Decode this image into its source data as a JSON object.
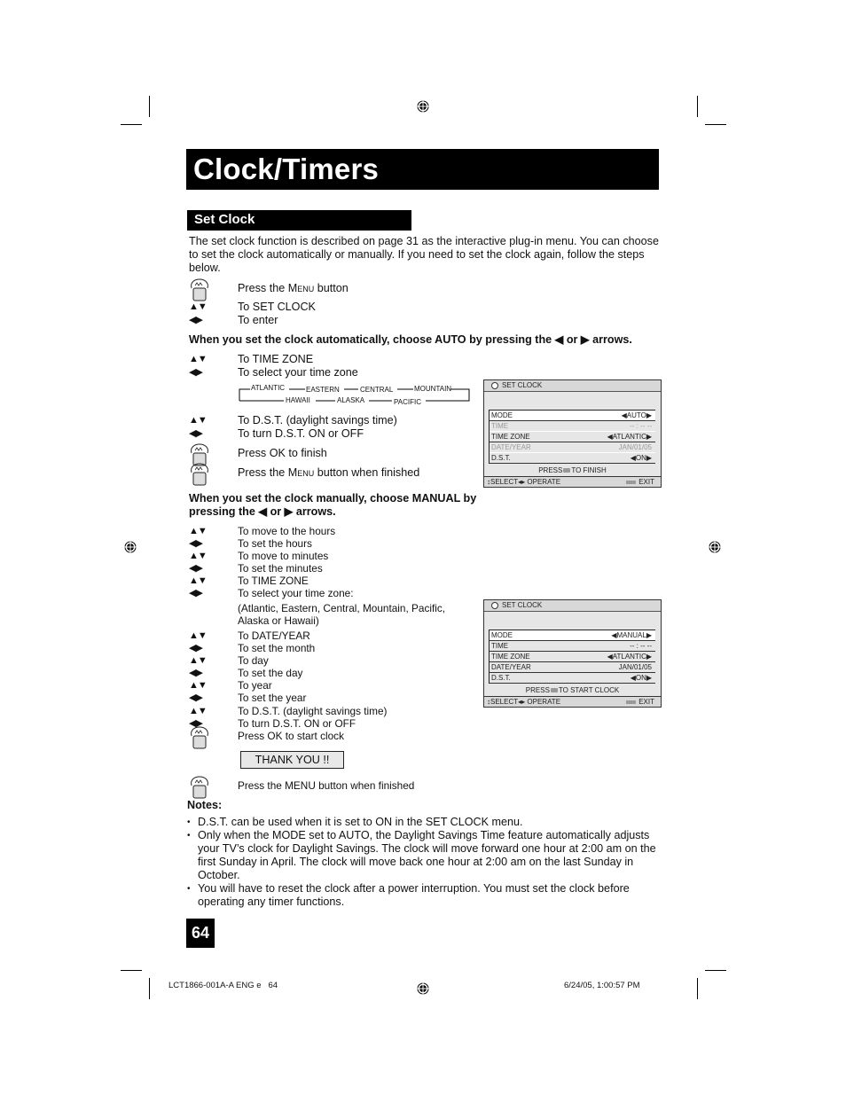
{
  "page": {
    "title": "Clock/Timers",
    "section_title": "Set Clock",
    "intro": "The set clock function is described on page 31 as the interactive plug-in menu. You can choose to set the clock automatically or manually. If you need to set the clock again, follow the steps below.",
    "page_number": "64"
  },
  "icons": {
    "up_down": "▲▼",
    "left_right": "◀▶",
    "hand": "hand-press-icon"
  },
  "steps_intro": [
    {
      "icon": "hand",
      "text_pre": "Press the ",
      "text_sc": "Menu",
      "text_post": " button"
    },
    {
      "icon": "up_down",
      "text": "To SET CLOCK"
    },
    {
      "icon": "left_right",
      "text": "To enter"
    }
  ],
  "auto_heading": "When you set the clock automatically, choose AUTO by pressing the ◀ or ▶ arrows.",
  "steps_auto": [
    {
      "icon": "up_down",
      "text": "To TIME ZONE"
    },
    {
      "icon": "left_right",
      "text": "To select your time zone"
    },
    {
      "icon": "up_down",
      "text": "To D.S.T. (daylight savings time)"
    },
    {
      "icon": "left_right",
      "text": "To turn D.S.T. ON or OFF"
    },
    {
      "icon": "hand",
      "text": "Press OK to finish"
    },
    {
      "icon": "hand",
      "text_pre": "Press the ",
      "text_sc": "Menu",
      "text_post": " button when finished"
    }
  ],
  "timezone_cycle": {
    "top": [
      "ATLANTIC",
      "EASTERN",
      "CENTRAL",
      "MOUNTAIN"
    ],
    "bottom": [
      "HAWAII",
      "ALASKA",
      "PACIFIC"
    ]
  },
  "osd_auto": {
    "header": "SET CLOCK",
    "rows": [
      {
        "label": "MODE",
        "value": "AUTO",
        "arrows": true,
        "state": "highlighted"
      },
      {
        "label": "TIME",
        "value": "-- : -- --",
        "arrows": false,
        "state": "dimmed"
      },
      {
        "label": "TIME ZONE",
        "value": "ATLANTIC",
        "arrows": true,
        "state": "normal"
      },
      {
        "label": "DATE/YEAR",
        "value": "JAN/01/05",
        "arrows": false,
        "state": "dimmed"
      },
      {
        "label": "D.S.T.",
        "value": "ON",
        "arrows": true,
        "state": "normal"
      }
    ],
    "press_pre": "PRESS",
    "press_post": "TO FINISH",
    "footer_left": "SELECT",
    "footer_mid": "OPERATE",
    "footer_right": "EXIT"
  },
  "manual_heading": "When you set the clock manually, choose MANUAL by pressing the ◀ or ▶ arrows.",
  "steps_manual": [
    {
      "icon": "up_down",
      "text": "To move to the hours"
    },
    {
      "icon": "left_right",
      "text": "To set the hours"
    },
    {
      "icon": "up_down",
      "text": "To move to minutes"
    },
    {
      "icon": "left_right",
      "text": "To set the minutes"
    },
    {
      "icon": "up_down",
      "text": "To TIME ZONE"
    },
    {
      "icon": "left_right",
      "text": "To select your time zone:"
    },
    {
      "icon": "",
      "text": "(Atlantic, Eastern, Central, Mountain, Pacific,"
    },
    {
      "icon": "",
      "text": "Alaska or Hawaii)"
    },
    {
      "icon": "up_down",
      "text": "To DATE/YEAR"
    },
    {
      "icon": "left_right",
      "text": "To set the month"
    },
    {
      "icon": "up_down",
      "text": "To day"
    },
    {
      "icon": "left_right",
      "text": "To set the day"
    },
    {
      "icon": "up_down",
      "text": "To year"
    },
    {
      "icon": "left_right",
      "text": "To set the year"
    },
    {
      "icon": "up_down",
      "text": "To D.S.T. (daylight savings time)"
    },
    {
      "icon": "left_right",
      "text": "To turn D.S.T. ON or OFF"
    },
    {
      "icon": "hand",
      "text": "Press OK to start clock"
    }
  ],
  "thank_you": "THANK YOU !!",
  "final_step": "Press the MENU button when finished",
  "osd_manual": {
    "header": "SET CLOCK",
    "rows": [
      {
        "label": "MODE",
        "value": "MANUAL",
        "arrows": true,
        "state": "highlighted"
      },
      {
        "label": "TIME",
        "value": "-- : -- --",
        "arrows": false,
        "state": "normal"
      },
      {
        "label": "TIME ZONE",
        "value": "ATLANTIC",
        "arrows": true,
        "state": "normal"
      },
      {
        "label": "DATE/YEAR",
        "value": "JAN/01/05",
        "arrows": false,
        "state": "normal"
      },
      {
        "label": "D.S.T.",
        "value": "ON",
        "arrows": true,
        "state": "normal"
      }
    ],
    "press_pre": "PRESS",
    "press_post": "TO START CLOCK",
    "footer_left": "SELECT",
    "footer_mid": "OPERATE",
    "footer_right": "EXIT"
  },
  "notes": {
    "heading": "Notes:",
    "items": [
      "D.S.T. can be used when it is set to ON in the SET CLOCK menu.",
      "Only when the MODE set to AUTO, the Daylight Savings Time feature automatically adjusts your TV’s clock for Daylight Savings. The clock will move forward one hour at 2:00 am on the first Sunday in April. The clock will move back one hour at 2:00 am on the last Sunday in October.",
      "You will have to reset the clock after a power interruption. You must set the clock before operating any timer functions."
    ]
  },
  "footer": {
    "left": "LCT1866-001A-A ENG e   64",
    "right": "6/24/05, 1:00:57 PM"
  }
}
